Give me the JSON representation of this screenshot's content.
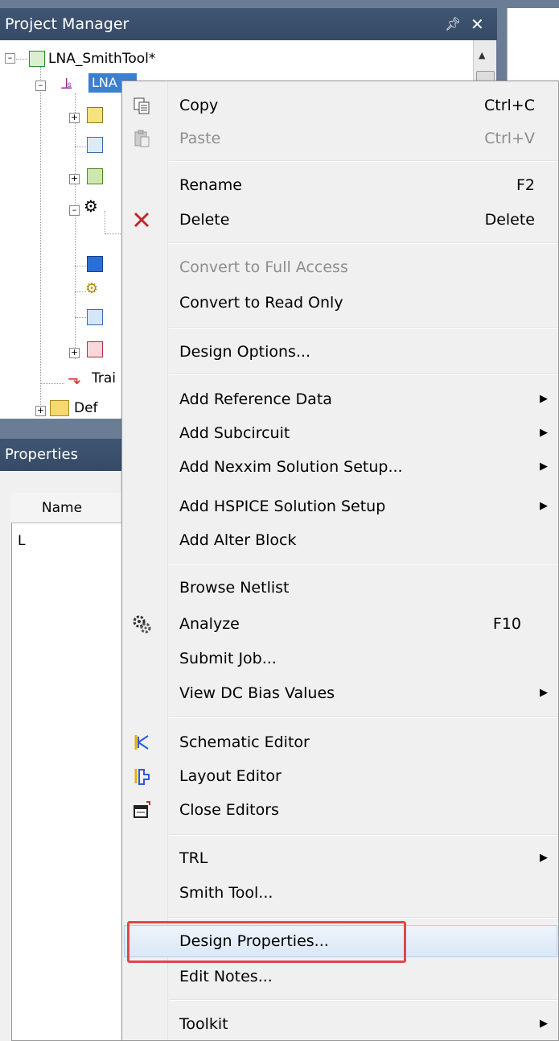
{
  "project_manager": {
    "title": "Project Manager",
    "pin_icon": "pin-icon",
    "close_icon": "close-icon",
    "tree": {
      "root": "LNA_SmithTool*",
      "design": "LNA",
      "traces_item": "Trai",
      "definitions_item": "Def"
    }
  },
  "properties": {
    "title": "Properties",
    "column_name": "Name",
    "row_value": "L"
  },
  "context_menu": {
    "items": [
      {
        "label": "Copy",
        "shortcut": "Ctrl+C",
        "icon": "copy-icon"
      },
      {
        "label": "Paste",
        "shortcut": "Ctrl+V",
        "icon": "paste-icon",
        "disabled": true
      },
      {
        "label": "Rename",
        "shortcut": "F2"
      },
      {
        "label": "Delete",
        "shortcut": "Delete",
        "icon": "delete-icon"
      },
      {
        "label": "Convert to Full Access",
        "disabled": true
      },
      {
        "label": "Convert to Read Only"
      },
      {
        "label": "Design Options..."
      },
      {
        "label": "Add Reference Data",
        "submenu": true
      },
      {
        "label": "Add Subcircuit",
        "submenu": true
      },
      {
        "label": "Add Nexxim Solution Setup...",
        "submenu": true
      },
      {
        "label": "Add HSPICE Solution Setup",
        "submenu": true
      },
      {
        "label": "Add Alter Block"
      },
      {
        "label": "Browse Netlist"
      },
      {
        "label": "Analyze",
        "shortcut": "F10",
        "icon": "analyze-icon"
      },
      {
        "label": "Submit Job..."
      },
      {
        "label": "View DC Bias Values",
        "submenu": true
      },
      {
        "label": "Schematic Editor",
        "icon": "schematic-editor-icon"
      },
      {
        "label": "Layout Editor",
        "icon": "layout-editor-icon"
      },
      {
        "label": "Close Editors",
        "icon": "close-editors-icon"
      },
      {
        "label": "TRL",
        "submenu": true
      },
      {
        "label": "Smith Tool..."
      },
      {
        "label": "Design Properties...",
        "highlighted": true
      },
      {
        "label": "Edit Notes..."
      },
      {
        "label": "Toolkit",
        "submenu": true
      }
    ]
  },
  "colors": {
    "title_bar": "#3f5673",
    "selection": "#3b7fd1",
    "menu_bg": "#f0f0f0",
    "highlight_border": "#e0474a",
    "delete_red": "#c0292b"
  }
}
